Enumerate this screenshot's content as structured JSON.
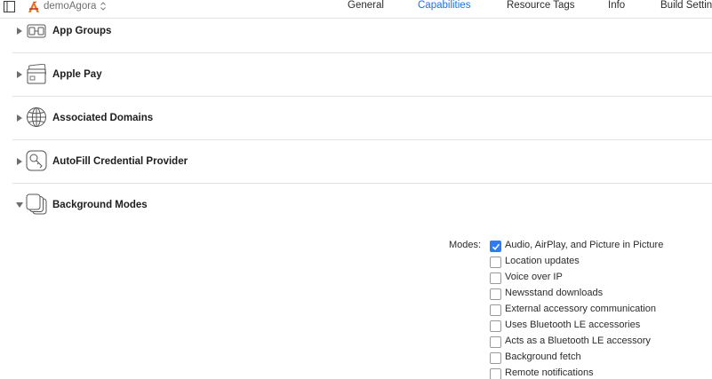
{
  "header": {
    "target_name": "demoAgora",
    "tabs": [
      {
        "label": "General",
        "active": false
      },
      {
        "label": "Capabilities",
        "active": true
      },
      {
        "label": "Resource Tags",
        "active": false
      },
      {
        "label": "Info",
        "active": false
      },
      {
        "label": "Build Settin",
        "active": false
      }
    ],
    "active_tab_color": "#1e6fe0"
  },
  "capabilities": [
    {
      "label": "App Groups",
      "expanded": false,
      "icon": "app-groups-icon"
    },
    {
      "label": "Apple Pay",
      "expanded": false,
      "icon": "wallet-icon"
    },
    {
      "label": "Associated Domains",
      "expanded": false,
      "icon": "globe-icon"
    },
    {
      "label": "AutoFill Credential Provider",
      "expanded": false,
      "icon": "key-icon"
    },
    {
      "label": "Background Modes",
      "expanded": true,
      "icon": "background-modes-icon"
    }
  ],
  "background_modes": {
    "label": "Modes:",
    "options": [
      {
        "label": "Audio, AirPlay, and Picture in Picture",
        "checked": true
      },
      {
        "label": "Location updates",
        "checked": false
      },
      {
        "label": "Voice over IP",
        "checked": false
      },
      {
        "label": "Newsstand downloads",
        "checked": false
      },
      {
        "label": "External accessory communication",
        "checked": false
      },
      {
        "label": "Uses Bluetooth LE accessories",
        "checked": false
      },
      {
        "label": "Acts as a Bluetooth LE accessory",
        "checked": false
      },
      {
        "label": "Background fetch",
        "checked": false
      },
      {
        "label": "Remote notifications",
        "checked": false
      }
    ],
    "checked_color": "#2d7cf6"
  }
}
